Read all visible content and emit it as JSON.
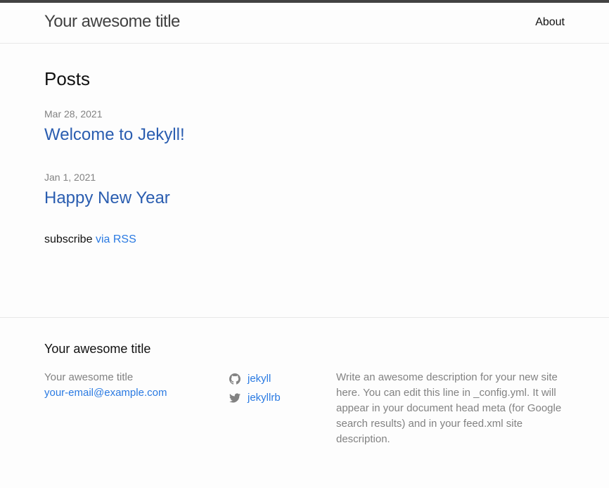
{
  "header": {
    "site_title": "Your awesome title",
    "nav": [
      {
        "label": "About"
      }
    ]
  },
  "main": {
    "heading": "Posts",
    "posts": [
      {
        "date": "Mar 28, 2021",
        "title": "Welcome to Jekyll!"
      },
      {
        "date": "Jan 1, 2021",
        "title": "Happy New Year"
      }
    ],
    "rss_prefix": "subscribe",
    "rss_link": "via RSS"
  },
  "footer": {
    "heading": "Your awesome title",
    "name": "Your awesome title",
    "email": "your-email@example.com",
    "social": [
      {
        "icon": "github-icon",
        "label": "jekyll"
      },
      {
        "icon": "twitter-icon",
        "label": "jekyllrb"
      }
    ],
    "description": "Write an awesome description for your new site here. You can edit this line in _config.yml. It will appear in your document head meta (for Google search results) and in your feed.xml site description."
  },
  "colors": {
    "link": "#2a7ae2",
    "muted": "#828282",
    "topbar": "#424242",
    "border": "#e8e8e8"
  }
}
